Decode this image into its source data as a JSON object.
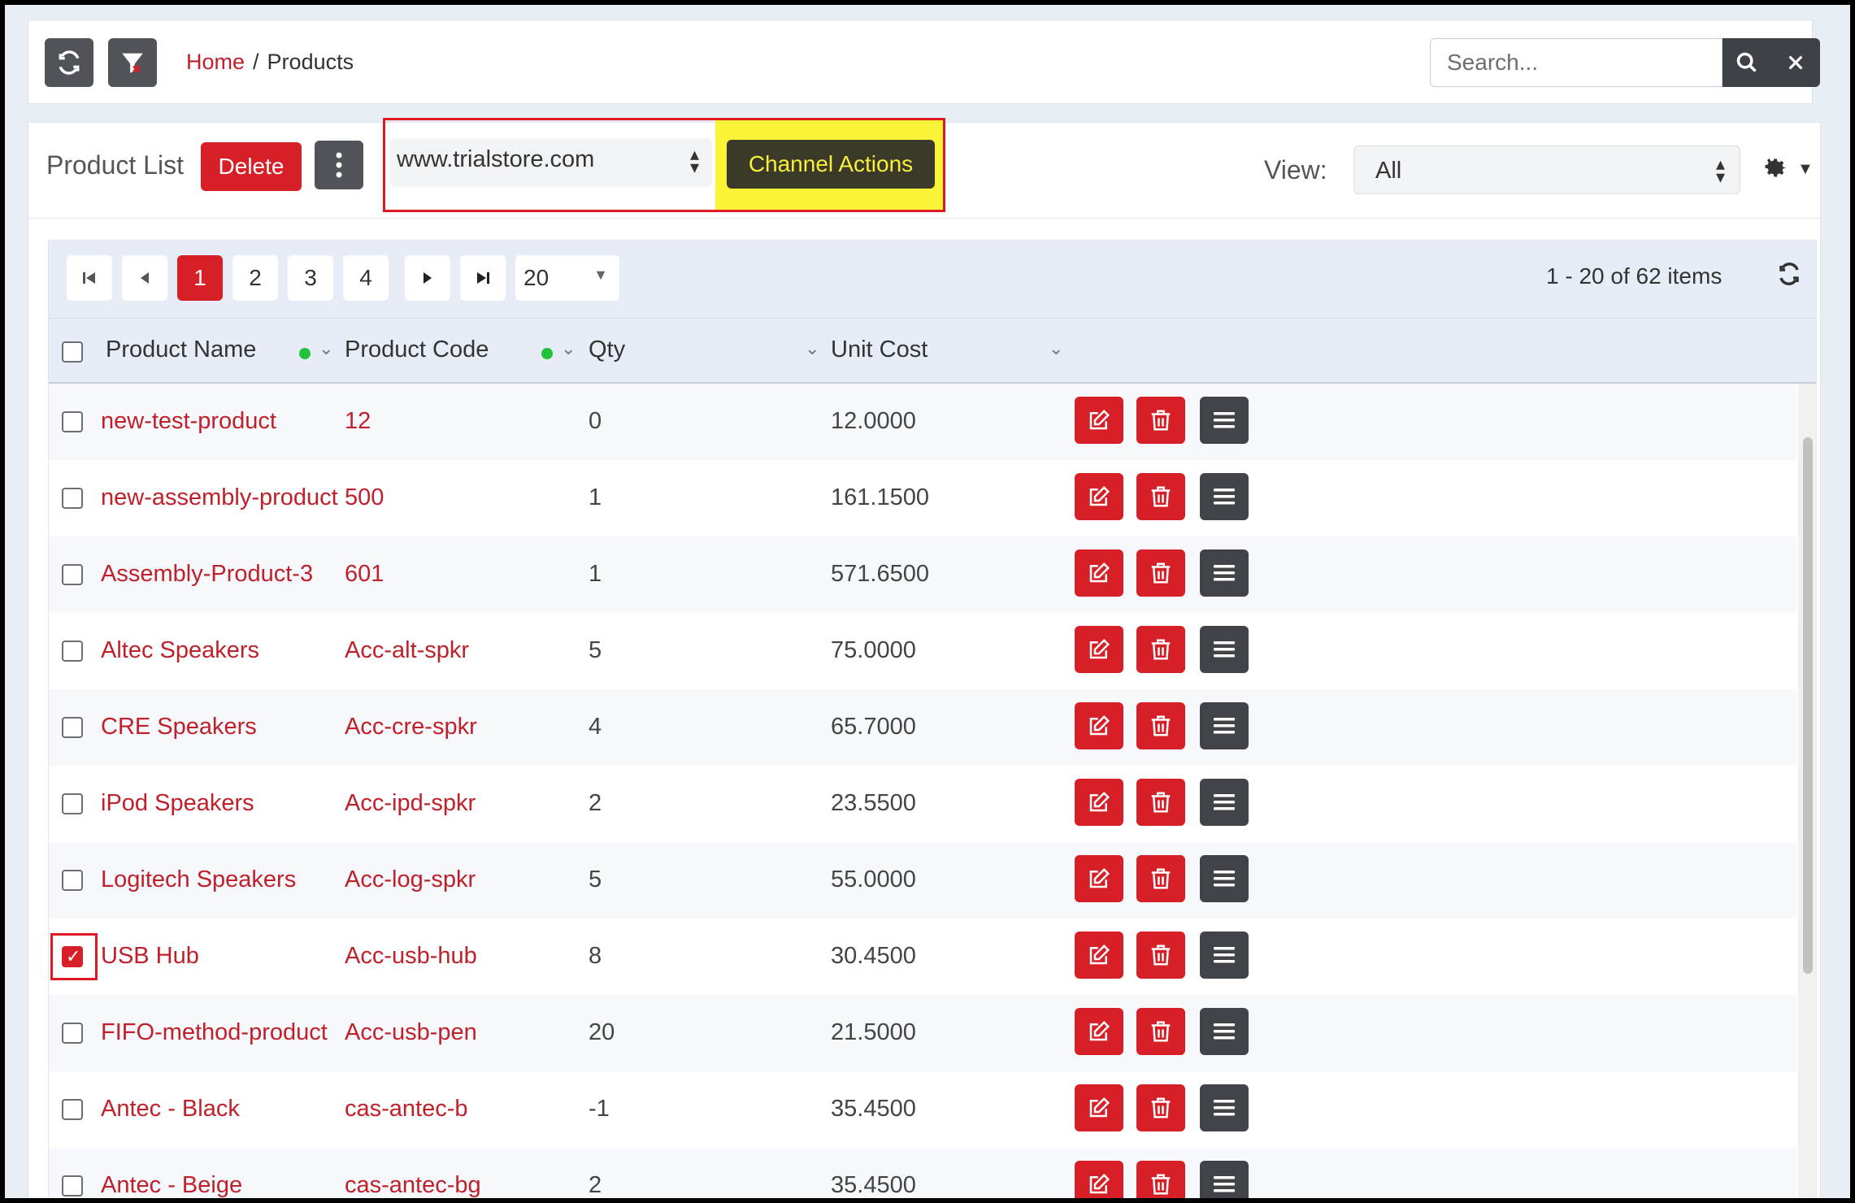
{
  "topbar": {
    "refresh_icon": "refresh-icon",
    "filter_icon": "filter-clear-icon",
    "breadcrumb": {
      "home": "Home",
      "separator": "/",
      "current": "Products"
    },
    "search": {
      "placeholder": "Search...",
      "value": ""
    }
  },
  "header": {
    "title": "Product List",
    "delete_label": "Delete",
    "channel_select": "www.trialstore.com",
    "channel_actions_label": "Channel Actions",
    "view_label": "View:",
    "view_value": "All"
  },
  "pager": {
    "pages": [
      "1",
      "2",
      "3",
      "4"
    ],
    "active_page": "1",
    "page_size": "20",
    "summary": "1 - 20 of 62 items"
  },
  "columns": {
    "name": "Product Name",
    "code": "Product Code",
    "qty": "Qty",
    "cost": "Unit Cost"
  },
  "rows": [
    {
      "name": "new-test-product",
      "code": "12",
      "qty": "0",
      "cost": "12.0000",
      "checked": false
    },
    {
      "name": "new-assembly-product",
      "code": "500",
      "qty": "1",
      "cost": "161.1500",
      "checked": false
    },
    {
      "name": "Assembly-Product-3",
      "code": "601",
      "qty": "1",
      "cost": "571.6500",
      "checked": false
    },
    {
      "name": "Altec Speakers",
      "code": "Acc-alt-spkr",
      "qty": "5",
      "cost": "75.0000",
      "checked": false
    },
    {
      "name": "CRE Speakers",
      "code": "Acc-cre-spkr",
      "qty": "4",
      "cost": "65.7000",
      "checked": false
    },
    {
      "name": "iPod Speakers",
      "code": "Acc-ipd-spkr",
      "qty": "2",
      "cost": "23.5500",
      "checked": false
    },
    {
      "name": "Logitech Speakers",
      "code": "Acc-log-spkr",
      "qty": "5",
      "cost": "55.0000",
      "checked": false
    },
    {
      "name": "USB Hub",
      "code": "Acc-usb-hub",
      "qty": "8",
      "cost": "30.4500",
      "checked": true
    },
    {
      "name": "FIFO-method-product",
      "code": "Acc-usb-pen",
      "qty": "20",
      "cost": "21.5000",
      "checked": false
    },
    {
      "name": "Antec - Black",
      "code": "cas-antec-b",
      "qty": "-1",
      "cost": "35.4500",
      "checked": false
    },
    {
      "name": "Antec - Beige",
      "code": "cas-antec-bg",
      "qty": "2",
      "cost": "35.4500",
      "checked": false
    }
  ],
  "colors": {
    "accent": "#d71f27",
    "dark": "#404347",
    "highlight": "#fbf338",
    "status_dot": "#22c33a"
  }
}
